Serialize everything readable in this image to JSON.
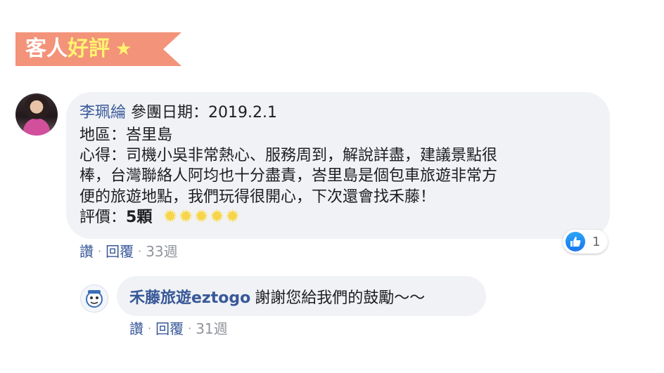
{
  "banner": {
    "title_white": "客人",
    "title_yellow": "好評",
    "star": "★"
  },
  "comment": {
    "author": "李珮綸",
    "date_text": " 參團日期：2019.2.1",
    "region": "地區：峇里島",
    "body_line1": "心得：司機小吳非常熱心、服務周到，解說詳盡，建議景點很",
    "body_line2": "棒，台灣聯絡人阿均也十分盡責，峇里島是個包車旅遊非常方",
    "body_line3": "便的旅遊地點，我們玩得很開心，下次還會找禾藤！",
    "rating_label": "評價：",
    "rating_value": "5顆",
    "rating_stars": 5,
    "reactions": {
      "icon": "like-icon",
      "count": "1"
    },
    "actions": {
      "like": "讚",
      "reply": "回覆",
      "time": "33週"
    }
  },
  "reply": {
    "author": "禾藤旅遊eztogo",
    "text": "謝謝您給我們的鼓勵～～",
    "actions": {
      "like": "讚",
      "reply": "回覆",
      "time": "31週"
    }
  },
  "colors": {
    "banner": "#f3937a",
    "banner_accent": "#fff36e",
    "link": "#385898",
    "bubble": "#f0f2f5",
    "like": "#1877f2"
  }
}
